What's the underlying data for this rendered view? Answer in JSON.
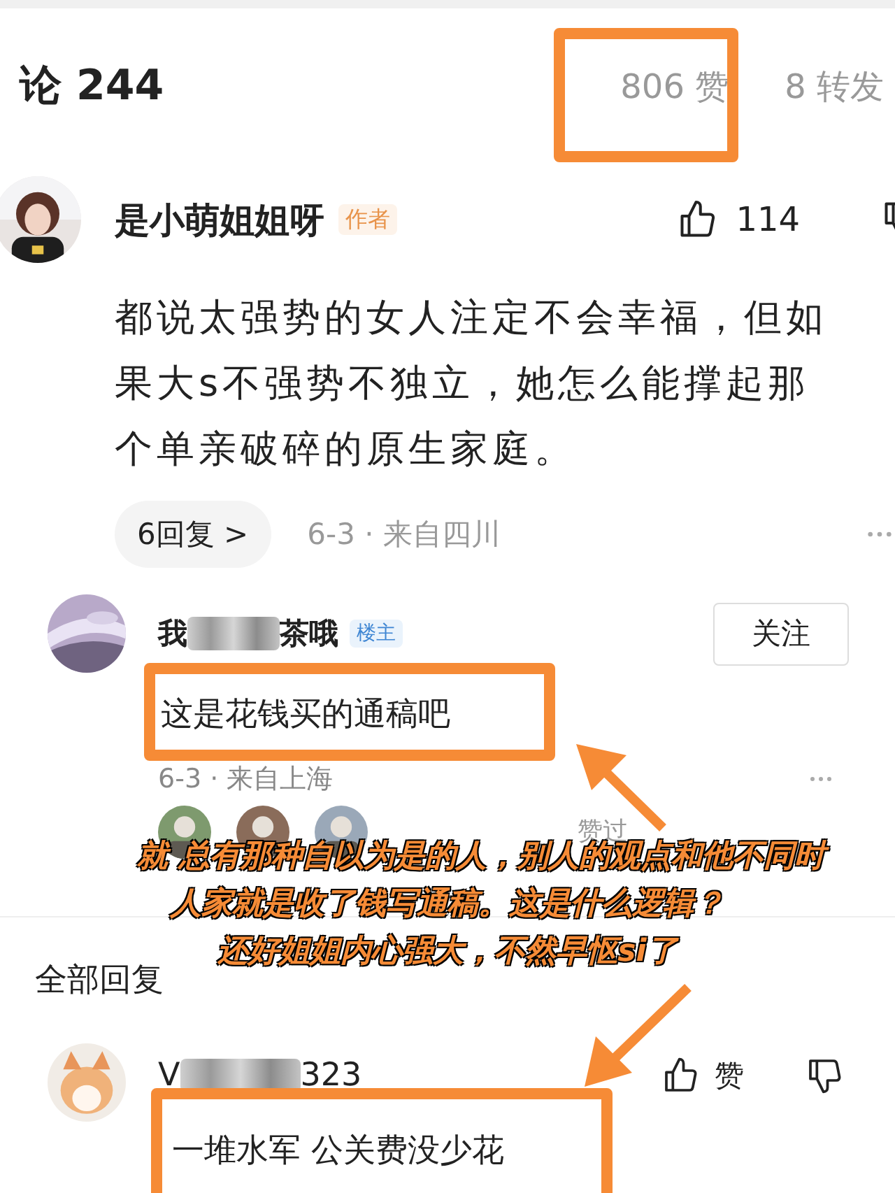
{
  "header": {
    "title": "论 244",
    "likes": "806 赞",
    "shares": "8 转发"
  },
  "comment": {
    "author": "是小萌姐姐呀",
    "badge": "作者",
    "like_count": "114",
    "body_lines": [
      "都说太强势的女人注定不会幸福，但如",
      "果大s不强势不独立，她怎么能撑起那",
      "个单亲破碎的原生家庭。"
    ],
    "replies_button": "6回复 >",
    "meta": "6-3 · 来自四川"
  },
  "reply": {
    "author_start": "我",
    "author_end": "茶哦",
    "badge": "楼主",
    "follow_button": "关注",
    "text": "这是花钱买的通稿吧",
    "meta": "6-3 · 来自上海",
    "liked_by": "赞过"
  },
  "all_replies_label": "全部回复",
  "reply_2": {
    "author_start": "V",
    "author_end": "323",
    "like_label": "赞",
    "text": "一堆水军 公关费没少花"
  },
  "annotation": {
    "lines": [
      "就 总有那种自以为是的人，别人的观点和他不同时",
      "人家就是收了钱写通稿。这是什么逻辑？",
      "还好姐姐内心强大，不然早怄si了"
    ]
  }
}
